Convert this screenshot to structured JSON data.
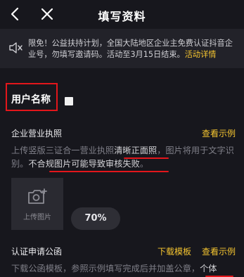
{
  "nav": {
    "title": "填写资料",
    "back_icon": "chevron-left-icon",
    "close_icon": "close-icon"
  },
  "notice": {
    "icon": "speaker-icon",
    "text": "限免！公益扶持计划，全国大陆地区企业主免费认证抖音企业号，勿填写邀请码。活动至3月15日结束。",
    "link": "活动详情"
  },
  "username": {
    "label": "用户名称"
  },
  "license": {
    "title": "企业营业执照",
    "example": "查看示例",
    "desc_before": "上传竖版三证合一营业执照",
    "desc_highlight1": "清晰正面照",
    "desc_mid": "，图片将用于文字识别。",
    "desc_highlight2": "不合规图片可能导致审核失败",
    "desc_end": "。",
    "upload_label": "上传图片",
    "upload_icon": "add-photo-icon"
  },
  "zoom_level": "70%",
  "letter": {
    "title": "认证申请公函",
    "download": "下载模板",
    "example": "查看示例",
    "desc": "下载公函模板，参照示例填写完成后并加盖公章，",
    "desc_highlight": "个体"
  },
  "colors": {
    "background": "#17171d",
    "accent": "#f4c430",
    "annotation": "#e3161b"
  }
}
